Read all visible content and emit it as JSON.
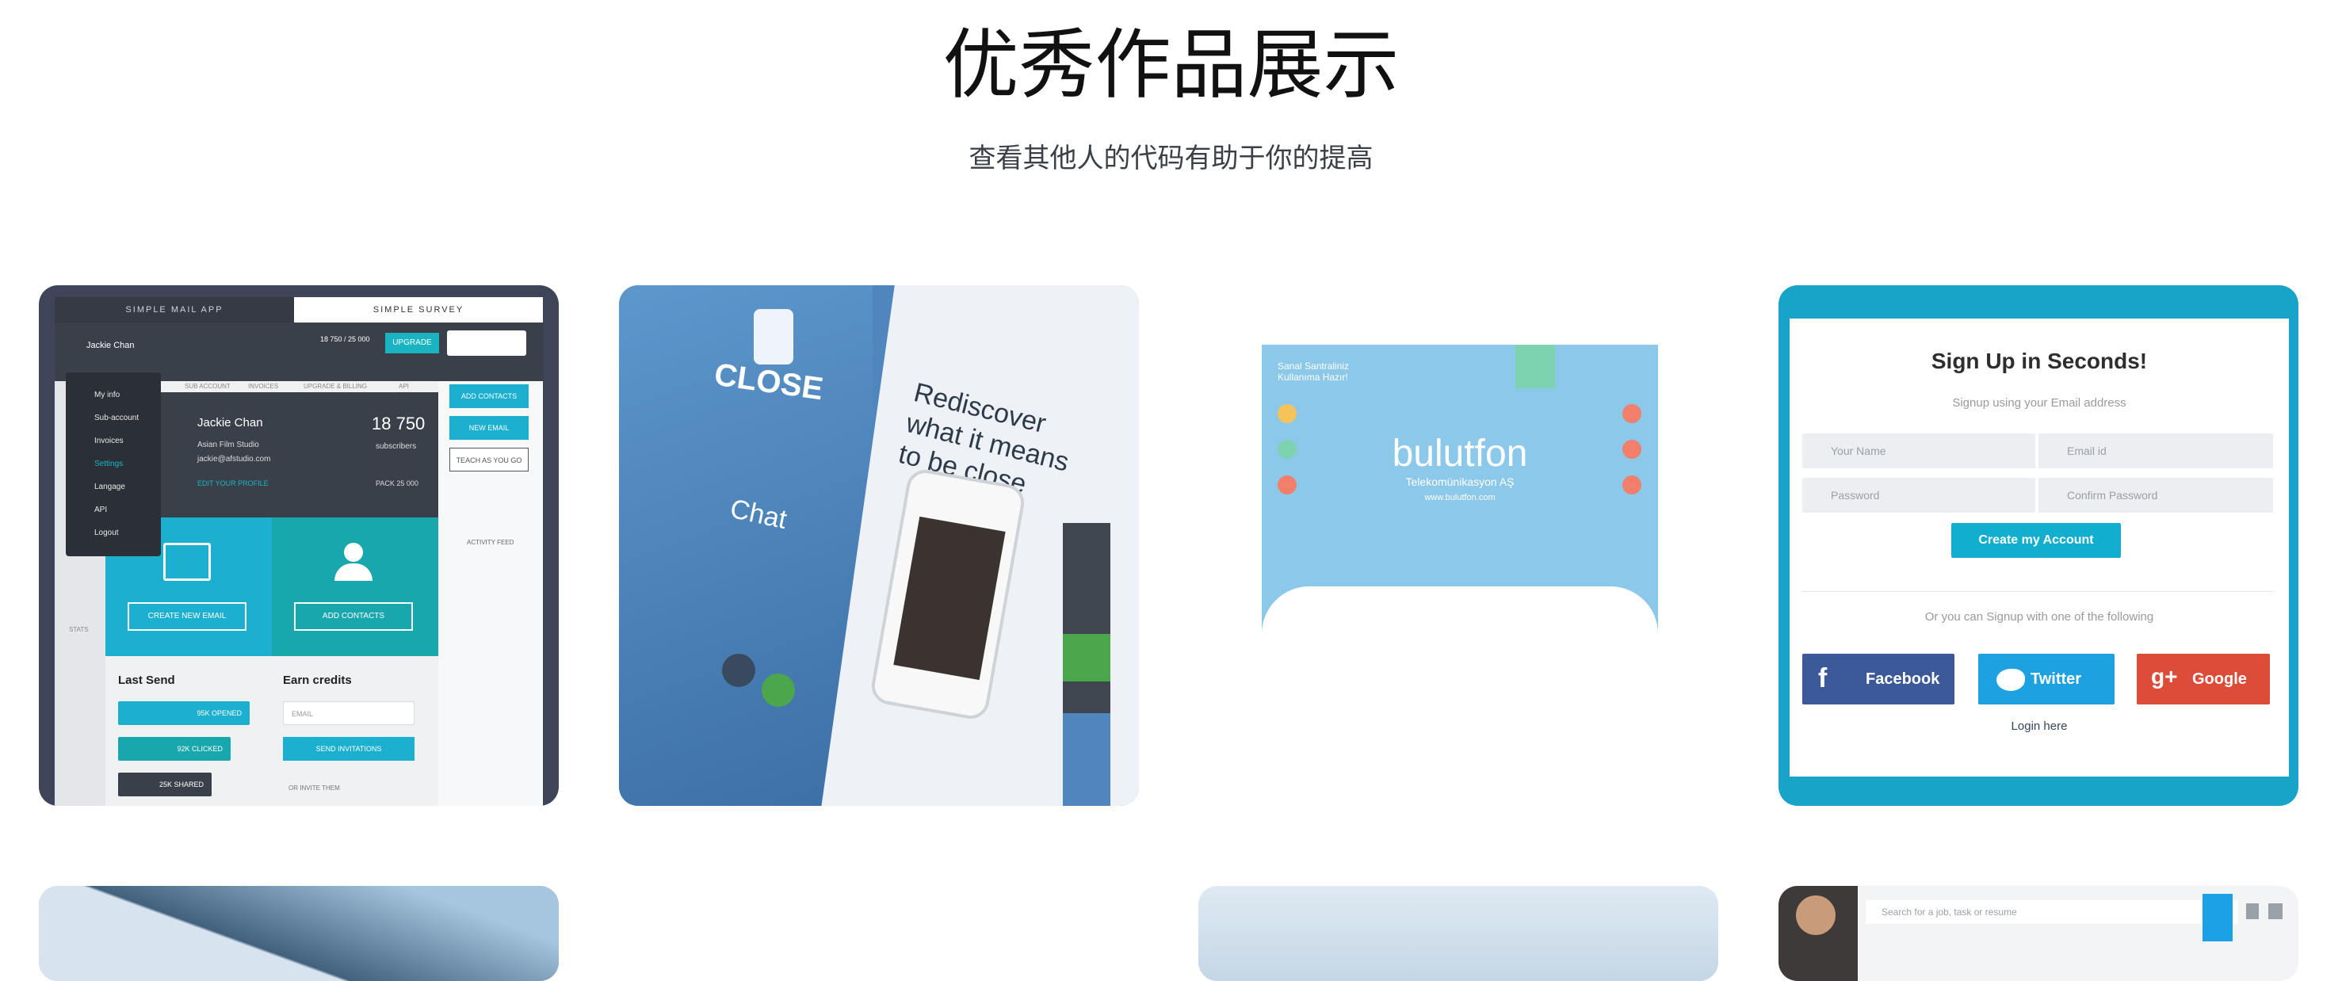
{
  "section": {
    "title": "优秀作品展示",
    "subtitle": "查看其他人的代码有助于你的提高"
  },
  "card1": {
    "tab_left": "SIMPLE MAIL APP",
    "tab_right": "SIMPLE SURVEY",
    "user": "Jackie Chan",
    "quota": "18 750 / 25 000",
    "upgrade": "UPGRADE",
    "menu": [
      "My info",
      "Sub-account",
      "Invoices",
      "Settings",
      "Langage",
      "API",
      "Logout"
    ],
    "nav": [
      "SUB ACCOUNT",
      "INVOICES",
      "UPGRADE & BILLING",
      "API"
    ],
    "profile_name": "Jackie Chan",
    "profile_company": "Asian Film Studio",
    "profile_email": "jackie@afstudio.com",
    "profile_edit": "EDIT YOUR PROFILE",
    "subscribers_count": "18 750",
    "subscribers_label": "subscribers",
    "pack": "PACK 25 000",
    "create_email": "CREATE NEW EMAIL",
    "add_contacts_tile": "ADD CONTACTS",
    "side_add_contacts": "ADD CONTACTS",
    "side_new_email": "NEW EMAIL",
    "side_teach": "TEACH AS YOU GO",
    "activity": "ACTIVITY FEED",
    "stats": "STATS",
    "last_send": "Last Send",
    "earn_credits": "Earn credits",
    "opened": "95K OPENED",
    "clicked": "92K CLICKED",
    "shared": "25K SHARED",
    "email_ph": "EMAIL",
    "send_inv": "SEND INVITATIONS",
    "invite": "OR INVITE THEM"
  },
  "card2": {
    "close": "CLOSE",
    "chat": "Chat",
    "tagline": "Rediscover what it means to be close"
  },
  "card3": {
    "logo": "bulutfon",
    "logo_sub": "Telekomünikasyon AŞ",
    "site": "www.bulutfon.com",
    "heading": "Sanal Santraliniz Kullanıma Hazır!"
  },
  "card4": {
    "heading": "Sign Up in Seconds!",
    "sub": "Signup using your Email address",
    "name_ph": "Your Name",
    "email_ph": "Email id",
    "pass_ph": "Password",
    "confirm_ph": "Confirm Password",
    "cta": "Create my Account",
    "or": "Or you can Signup with one of the following",
    "facebook": "Facebook",
    "twitter": "Twitter",
    "google": "Google",
    "login": "Login here",
    "colors": {
      "facebook": "#3b5998",
      "twitter": "#1da1e0",
      "google": "#dd4b39",
      "accent": "#12aecf"
    }
  },
  "card8": {
    "search_ph": "Search for a job, task or resume"
  }
}
